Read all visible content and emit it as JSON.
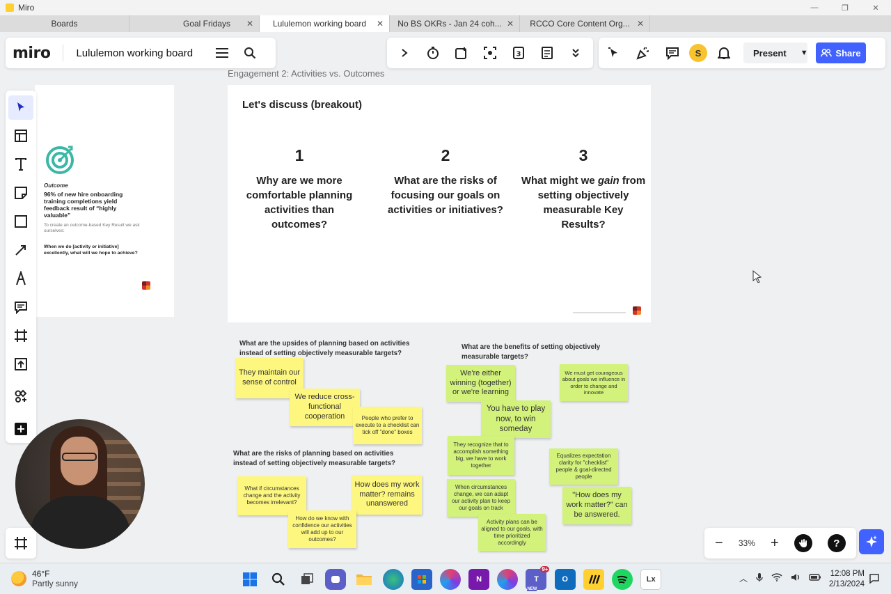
{
  "window": {
    "title": "Miro",
    "controls": [
      "—",
      "❐",
      "✕"
    ]
  },
  "tabs": [
    {
      "label": "Boards",
      "active": false,
      "closable": false
    },
    {
      "label": "Goal Fridays",
      "active": false,
      "closable": true
    },
    {
      "label": "Lululemon working board",
      "active": true,
      "closable": true
    },
    {
      "label": "No BS OKRs - Jan 24 coh...",
      "active": false,
      "closable": true
    },
    {
      "label": "RCCO Core Content Org...",
      "active": false,
      "closable": true
    }
  ],
  "header": {
    "logo": "miro",
    "board_name": "Lululemon working board",
    "avatar_initial": "S",
    "present_label": "Present",
    "share_label": "Share"
  },
  "frames": {
    "label": "Engagement 2: Activities vs. Outcomes",
    "left": {
      "label": "Outcome",
      "heading": "96% of new hire onboarding training completions yield feedback result of “highly valuable”",
      "sub": "To create an outcome-based Key Result we ask ourselves:",
      "question": "When we do [activity or initiative] excellently, what will we hope to achieve?"
    },
    "main": {
      "title": "Let's discuss (breakout)",
      "columns": [
        {
          "number": "1",
          "question": "Why are we more comfortable planning activities than outcomes?"
        },
        {
          "number": "2",
          "question": "What are the risks of focusing our goals on activities or initiatives?"
        },
        {
          "number": "3",
          "question_pre": "What might we ",
          "question_em": "gain",
          "question_post": " from setting objectively measurable Key Results?"
        }
      ]
    }
  },
  "sections": {
    "upsides": {
      "title": "What are the upsides of planning based on activities instead of setting objectively measurable targets?",
      "stickies": [
        "They maintain our sense of control",
        "We reduce cross-functional cooperation",
        "People who prefer to execute to a checklist can tick off \"done\" boxes"
      ]
    },
    "risks": {
      "title": "What are the risks of planning based on activities instead of setting objectively measurable targets?",
      "stickies": [
        "What if circumstances change and the activity becomes irrelevant?",
        "How does my work matter? remains unanswered",
        "How do we know with confidence our activities will add up to our outcomes?"
      ]
    },
    "benefits": {
      "title": "What are the benefits of setting objectively measurable targets?",
      "stickies": [
        "We're either winning (together) or we're learning",
        "We must get courageous about goals we influence in order to change and innovate",
        "You have to play now, to win someday",
        "They recognize that to accomplish something big, we have to work together",
        "Equalizes expectation clarity for \"checklist\" people & goal-directed people",
        "\"How does my work matter?\" can be answered.",
        "When circumstances change, we can adapt our activity plan to keep our goals on track",
        "Activity plans can be aligned to our goals, with time prioritized accordingly"
      ]
    }
  },
  "zoom": {
    "level": "33%",
    "minus": "−",
    "plus": "+",
    "help": "?"
  },
  "taskbar": {
    "temperature": "46°F",
    "condition": "Partly sunny",
    "teams_badge": "9+",
    "teams_new": "NEW",
    "lx_label": "Lx",
    "time": "12:08 PM",
    "date": "2/13/2024"
  },
  "colors": {
    "accent": "#4262ff",
    "sticky_yellow": "#fdf77f",
    "sticky_green": "#d3f27c",
    "target_teal": "#3ab7a6"
  }
}
